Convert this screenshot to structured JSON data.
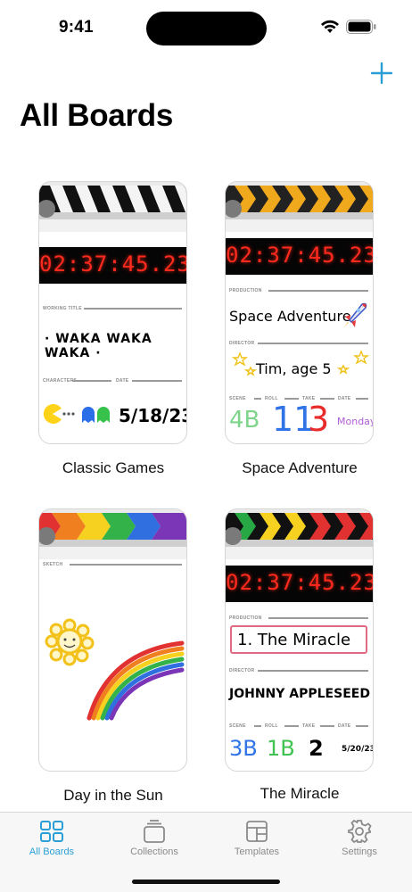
{
  "status": {
    "time": "9:41"
  },
  "header": {
    "title": "All Boards",
    "add_icon": "plus-icon"
  },
  "colors": {
    "accent": "#2a9fd6",
    "tab_inactive": "#8a8a8a",
    "timer_red": "#ff2a1e"
  },
  "boards": [
    {
      "name": "Classic Games",
      "timecode": "02:37:45.23",
      "fields": {
        "working_title_label": "WORKING TITLE",
        "working_title": "· WAKA WAKA WAKA ·",
        "characters_label": "CHARACTERS",
        "date_label": "DATE",
        "date": "5/18/23"
      }
    },
    {
      "name": "Space Adventure",
      "timecode": "02:37:45.23",
      "fields": {
        "production_label": "PRODUCTION",
        "production": "Space Adventure",
        "director_label": "DIRECTOR",
        "director": "Tim, age 5",
        "scene_label": "SCENE",
        "roll_label": "ROLL",
        "take_label": "TAKE",
        "date_label": "DATE",
        "scene": "4B",
        "roll": "11",
        "take": "3",
        "date": "Monday"
      }
    },
    {
      "name": "Day in the Sun",
      "fields": {
        "sketch_label": "SKETCH"
      }
    },
    {
      "name": "The Miracle",
      "timecode": "02:37:45.23",
      "fields": {
        "production_label": "PRODUCTION",
        "production": "1. The Miracle",
        "director_label": "DIRECTOR",
        "director": "JOHNNY APPLESEED",
        "scene_label": "SCENE",
        "roll_label": "ROLL",
        "take_label": "TAKE",
        "date_label": "DATE",
        "scene": "3B",
        "roll": "1B",
        "take": "2",
        "date": "5/20/23"
      }
    }
  ],
  "tabs": [
    {
      "label": "All Boards",
      "icon": "grid-icon",
      "active": true
    },
    {
      "label": "Collections",
      "icon": "stack-icon",
      "active": false
    },
    {
      "label": "Templates",
      "icon": "template-icon",
      "active": false
    },
    {
      "label": "Settings",
      "icon": "gear-icon",
      "active": false
    }
  ]
}
